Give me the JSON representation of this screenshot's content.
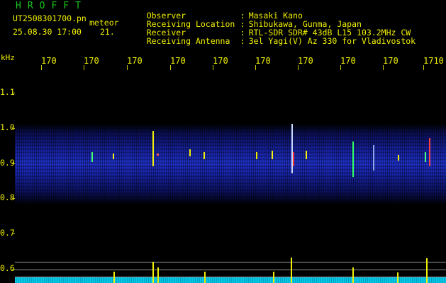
{
  "header": {
    "app_title": "HROFFT",
    "file_name": "UT2508301700.pn",
    "file_type": "meteor",
    "timestamp": "25.08.30 17:00",
    "meteor_count": "21."
  },
  "station_info": [
    {
      "label": "Observer",
      "sep": ":",
      "value": "Masaki Kano"
    },
    {
      "label": "Receiving Location",
      "sep": ":",
      "value": "Shibukawa, Gunma, Japan"
    },
    {
      "label": "Receiver",
      "sep": ":",
      "value": "RTL-SDR SDR# 43dB L15 103.2MHz CW"
    },
    {
      "label": "Receiving Antenna",
      "sep": ":",
      "value": "3el Yagi(V) Az 330 for Vladivostok"
    }
  ],
  "plot": {
    "unit_label": "kHz",
    "freq_ticks": [
      "170",
      "170",
      "170",
      "170",
      "170",
      "170",
      "170",
      "170",
      "170",
      "1710"
    ],
    "y_ticks": [
      "1.1",
      "1.0",
      "0.9",
      "0.8",
      "0.7",
      "0.6"
    ],
    "colors": {
      "background": "#000000",
      "text": "#f0f000",
      "title": "#19c81e",
      "noise_band": "#2a40d8",
      "level_band": "#00c8e6",
      "echo": "#f0f000"
    }
  }
}
